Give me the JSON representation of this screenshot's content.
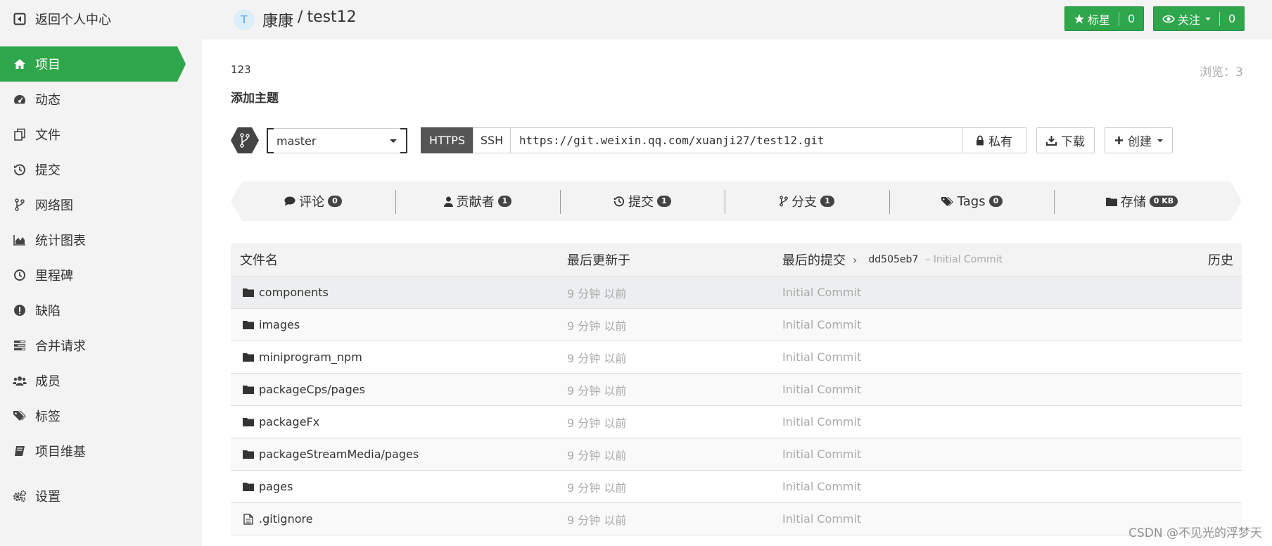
{
  "sidebar": {
    "back_label": "返回个人中心",
    "items": [
      {
        "label": "项目",
        "icon": "home-icon",
        "active": true
      },
      {
        "label": "动态",
        "icon": "dashboard-icon"
      },
      {
        "label": "文件",
        "icon": "files-icon"
      },
      {
        "label": "提交",
        "icon": "history-icon"
      },
      {
        "label": "网络图",
        "icon": "branch-icon"
      },
      {
        "label": "统计图表",
        "icon": "area-chart-icon"
      },
      {
        "label": "里程碑",
        "icon": "clock-icon"
      },
      {
        "label": "缺陷",
        "icon": "exclamation-icon"
      },
      {
        "label": "合并请求",
        "icon": "tasks-icon"
      },
      {
        "label": "成员",
        "icon": "users-icon"
      },
      {
        "label": "标签",
        "icon": "tags-icon"
      },
      {
        "label": "项目维基",
        "icon": "book-icon"
      },
      {
        "label": "设置",
        "icon": "cogs-icon"
      }
    ]
  },
  "header": {
    "avatar_letter": "T",
    "owner": "康康",
    "separator": "/",
    "project": "test12",
    "star_label": "标星",
    "star_count": "0",
    "watch_label": "关注",
    "watch_count": "0"
  },
  "project": {
    "description": "123",
    "views_label": "浏览：",
    "views": "3",
    "add_topic": "添加主题"
  },
  "clone": {
    "branch": "master",
    "https_label": "HTTPS",
    "ssh_label": "SSH",
    "url": "https://git.weixin.qq.com/xuanji27/test12.git",
    "private_label": "私有",
    "download_label": "下载",
    "create_label": "创建"
  },
  "stats": [
    {
      "label": "评论",
      "count": "0",
      "icon": "comment-icon"
    },
    {
      "label": "贡献者",
      "count": "1",
      "icon": "user-icon"
    },
    {
      "label": "提交",
      "count": "1",
      "icon": "history-icon"
    },
    {
      "label": "分支",
      "count": "1",
      "icon": "branch-icon"
    },
    {
      "label": "Tags",
      "count": "0",
      "icon": "tags-icon"
    },
    {
      "label": "存储",
      "count": "0 KB",
      "icon": "folder-icon"
    }
  ],
  "table": {
    "headers": {
      "name": "文件名",
      "updated": "最后更新于",
      "last_commit": "最后的提交",
      "commit_sha": "dd505eb7",
      "commit_message": "– Initial Commit",
      "history": "历史"
    },
    "rows": [
      {
        "name": "components",
        "type": "folder",
        "time": "9 分钟 以前",
        "commit": "Initial Commit"
      },
      {
        "name": "images",
        "type": "folder",
        "time": "9 分钟 以前",
        "commit": "Initial Commit"
      },
      {
        "name": "miniprogram_npm",
        "type": "folder",
        "time": "9 分钟 以前",
        "commit": "Initial Commit"
      },
      {
        "name": "packageCps/pages",
        "type": "folder",
        "time": "9 分钟 以前",
        "commit": "Initial Commit"
      },
      {
        "name": "packageFx",
        "type": "folder",
        "time": "9 分钟 以前",
        "commit": "Initial Commit"
      },
      {
        "name": "packageStreamMedia/pages",
        "type": "folder",
        "time": "9 分钟 以前",
        "commit": "Initial Commit"
      },
      {
        "name": "pages",
        "type": "folder",
        "time": "9 分钟 以前",
        "commit": "Initial Commit"
      },
      {
        "name": ".gitignore",
        "type": "file",
        "time": "9 分钟 以前",
        "commit": "Initial Commit"
      }
    ]
  },
  "watermark": "CSDN @不见光的浮梦天",
  "colors": {
    "accent": "#2ea64b",
    "dark": "#555555",
    "muted": "#aaaaaa"
  }
}
